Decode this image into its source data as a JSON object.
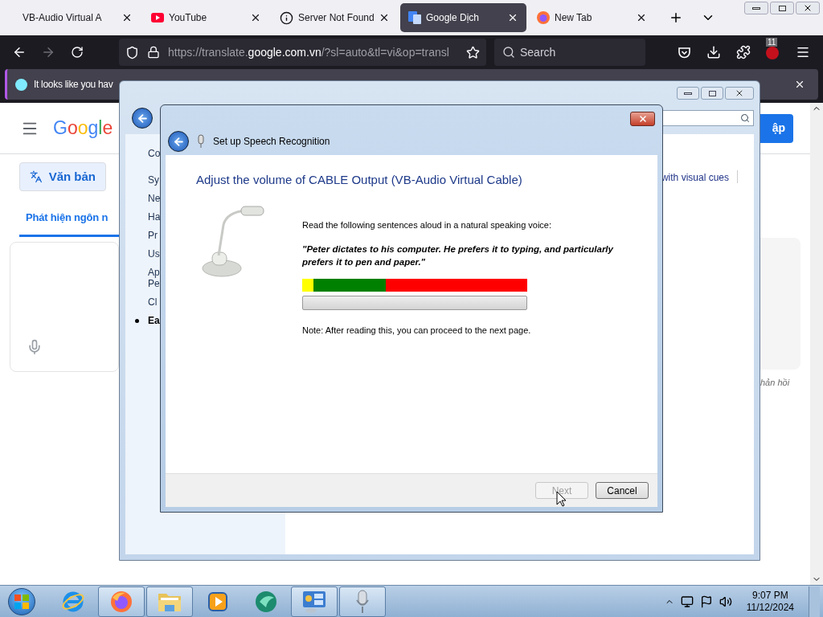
{
  "browser": {
    "tabs": [
      {
        "title": "VB-Audio Virtual A",
        "kind": "plain",
        "selected": false
      },
      {
        "title": "YouTube",
        "kind": "video",
        "selected": false
      },
      {
        "title": "Server Not Found",
        "kind": "error",
        "selected": false
      },
      {
        "title": "Google Dịch",
        "kind": "translate",
        "selected": true
      },
      {
        "title": "New Tab",
        "kind": "new",
        "selected": false
      }
    ],
    "url": {
      "prefix": "https://translate.",
      "domain": "google.com.vn",
      "rest": "/?sl=auto&tl=vi&op=transl"
    },
    "search_placeholder": "Search",
    "extension_badge": "11",
    "notification": "It looks like you hav"
  },
  "page": {
    "logo": "Google",
    "mode_button": "Văn bản",
    "source_tab": "Phát hiện ngôn n",
    "sign_in": "ập",
    "feedback": "hản hồi"
  },
  "control_panel": {
    "sidebar": [
      {
        "label": "Co",
        "current": false
      },
      {
        "label": "Sy",
        "current": false
      },
      {
        "label": "Ne",
        "current": false
      },
      {
        "label": "Ha",
        "current": false
      },
      {
        "label": "Pr",
        "current": false
      },
      {
        "label": "Us",
        "current": false
      },
      {
        "label": "Ap\nPe",
        "current": false
      },
      {
        "label": "Cl",
        "current": false
      },
      {
        "label": "Ea",
        "current": true
      }
    ],
    "link": "with visual cues"
  },
  "dialog": {
    "title": "Set up Speech Recognition",
    "heading": "Adjust the volume of CABLE Output (VB-Audio Virtual Cable)",
    "instruction": "Read the following sentences aloud in a natural speaking voice:",
    "quote": "\"Peter dictates to his computer. He prefers it to typing, and particularly prefers it to pen and paper.\"",
    "meter": {
      "level": 0
    },
    "note": "Note: After reading this, you can proceed to the next page.",
    "buttons": [
      {
        "label": "Next",
        "disabled": true
      },
      {
        "label": "Cancel",
        "disabled": false
      }
    ]
  },
  "taskbar": {
    "apps": [
      {
        "kind": "ie",
        "active": false
      },
      {
        "kind": "firefox",
        "active": true
      },
      {
        "kind": "explorer",
        "active": true
      },
      {
        "kind": "media",
        "active": false
      },
      {
        "kind": "app",
        "active": false
      },
      {
        "kind": "control-panel",
        "active": true
      },
      {
        "kind": "speech",
        "active": true
      }
    ],
    "time": "9:07 PM",
    "date": "11/12/2024"
  }
}
